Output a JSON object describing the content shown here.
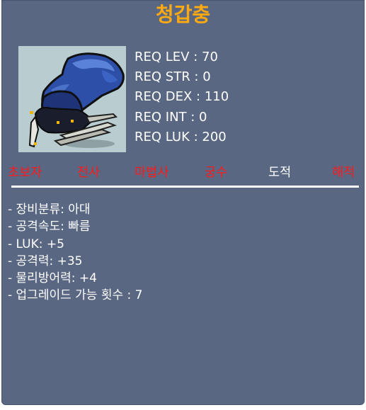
{
  "item": {
    "name": "청갑충",
    "icon": "blue-beetle-claw-icon"
  },
  "requirements": [
    "REQ LEV : 70",
    "REQ STR : 0",
    "REQ DEX : 110",
    "REQ INT : 0",
    "REQ LUK : 200"
  ],
  "jobs": [
    {
      "label": "초보자",
      "color": "#ff1a1a"
    },
    {
      "label": "전사",
      "color": "#ff1a1a"
    },
    {
      "label": "마법사",
      "color": "#ff1a1a"
    },
    {
      "label": "궁수",
      "color": "#ff1a1a"
    },
    {
      "label": "도적",
      "color": "#ffffff"
    },
    {
      "label": "해적",
      "color": "#ff1a1a"
    }
  ],
  "stats": [
    "- 장비분류: 아대",
    "- 공격속도: 빠름",
    "- LUK: +5",
    "- 공격력: +35",
    "- 물리방어력: +4",
    "- 업그레이드 가능 횟수 : 7"
  ],
  "colors": {
    "panel": "#5a6783",
    "title": "#ffaa11",
    "restricted_job": "#ff1a1a",
    "allowed_job": "#ffffff"
  }
}
